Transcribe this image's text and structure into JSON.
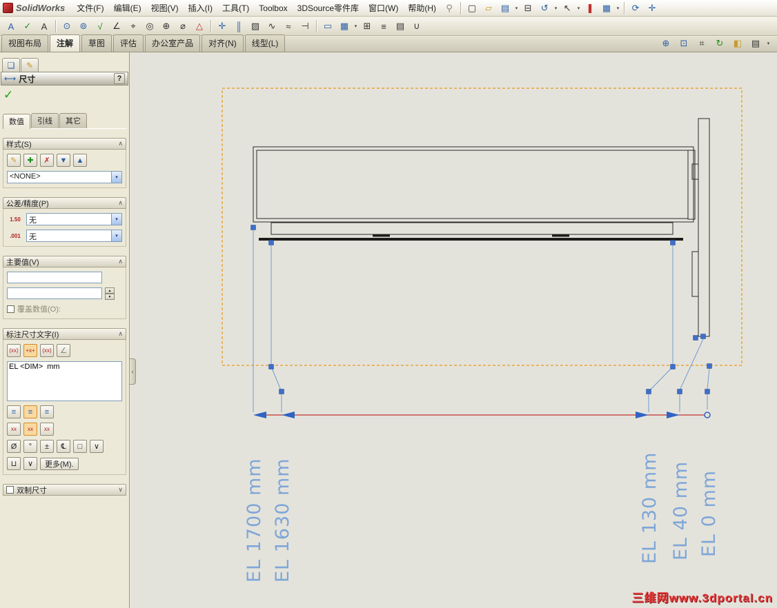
{
  "app": {
    "name": "SolidWorks"
  },
  "menubar": {
    "items": [
      "文件(F)",
      "编辑(E)",
      "视图(V)",
      "插入(I)",
      "工具(T)",
      "Toolbox",
      "3DSource零件库",
      "窗口(W)",
      "帮助(H)"
    ]
  },
  "cmd_tabs": [
    "视图布局",
    "注解",
    "草图",
    "评估",
    "办公室产品",
    "对齐(N)",
    "线型(L)"
  ],
  "icons": {
    "dropdown": "▾",
    "spin_up": "▴",
    "spin_down": "▾",
    "chevron_up": "∧",
    "chevron_down": "∨",
    "search": "⚲",
    "splitter": "‹",
    "new_doc": "▢",
    "open": "▱",
    "save": "▤",
    "print": "⊟",
    "undo": "↺",
    "select": "↖",
    "record": "❚",
    "display": "▦",
    "orientation": "⟳",
    "pan": "✛",
    "note": "A",
    "spell": "✓",
    "text_note": "A",
    "balloon": "⊙",
    "auto_balloon": "⊚",
    "surface_finish": "√",
    "weld_symbol": "∠",
    "geo_tolerance": "⌖",
    "datum_feature": "◎",
    "datum_target": "⊕",
    "hole_callout": "⌀",
    "revision_symbol": "△",
    "center_mark": "✛",
    "centerline": "║",
    "area_hatch": "▨",
    "jog_leader": "∿",
    "caterpillar": "≈",
    "end_treatment": "⊣",
    "block": "▭",
    "table": "▦",
    "hole_table": "⊞",
    "bom": "≡",
    "revision_table": "▤",
    "magnet_line": "∪",
    "zoom_fit": "⊕",
    "zoom_area": "⊡",
    "zoom_select": "⌗",
    "rebuild": "↻",
    "view_display": "◧",
    "sheet": "▤",
    "pm_tab_property": "❏",
    "pm_tab_custom": "✎",
    "pm_dim": "⟷",
    "style_new": "✎",
    "style_add": "✚",
    "style_del": "✗",
    "style_save": "▼",
    "style_load": "▲",
    "tol_icon": "1.50",
    "prec_icon": ".001",
    "dt_paren": "(xx)",
    "dt_plus": "+x+",
    "dt_paren2": "(xx)",
    "dt_leader": "∠",
    "align_left": "≡",
    "align_center": "≡",
    "align_right": "≡",
    "just_a": "xx",
    "just_b": "xx",
    "just_c": "xx",
    "sym_dia": "Ø",
    "sym_deg": "°",
    "sym_pm": "±",
    "sym_cl": "℄",
    "sym_sq": "□",
    "sym_u": "⊔",
    "sym_v": "∨"
  },
  "pm": {
    "title": "尺寸",
    "help": "?",
    "tabs": [
      "数值",
      "引线",
      "其它"
    ],
    "style": {
      "title": "样式(S)",
      "value": "<NONE>"
    },
    "tolerance": {
      "title": "公差/精度(P)",
      "tol_value": "无",
      "precision_value": "无"
    },
    "primary": {
      "title": "主要值(V)",
      "value1": "",
      "value2": "",
      "override_label": "覆盖数值(O):"
    },
    "dimtext": {
      "title": "标注尺寸文字(I)",
      "text": "EL <DIM>  mm",
      "more_label": "更多(M)."
    },
    "dual": {
      "title": "双制尺寸"
    }
  },
  "canvas": {
    "dim_labels": [
      "EL 1700  mm",
      "EL 1630  mm",
      "EL 130  mm",
      "EL 40  mm",
      "EL 0  mm"
    ],
    "watermark": "三维网www.3dportal.cn"
  }
}
